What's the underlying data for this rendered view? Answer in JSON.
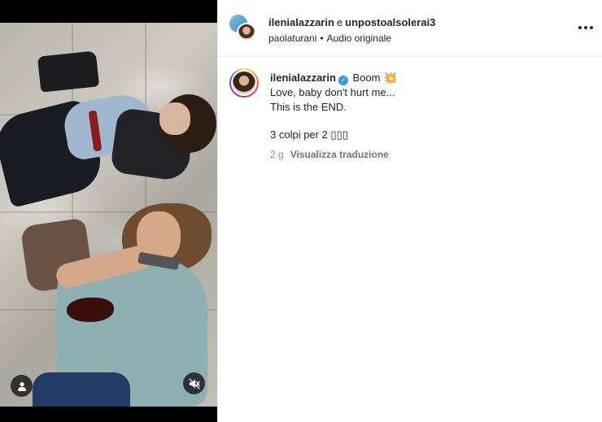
{
  "header": {
    "username1": "ilenialazzarin",
    "conjunction": "e",
    "username2": "unpostoalsolerai3",
    "audio_author": "paolaturani",
    "separator": "•",
    "audio_label": "Audio originale"
  },
  "caption": {
    "username": "ilenialazzarin",
    "verified_glyph": "✓",
    "first_word": "Boom",
    "burst_glyph": "💥",
    "line2": "Love, baby don't hurt me...",
    "line3": "This is the END.",
    "line4": "3 colpi per 2 ▯▯▯",
    "time_ago": "2 g",
    "translate_label": "Visualizza traduzione"
  },
  "icons": {
    "more": "more-options-icon",
    "user": "user-icon",
    "mute": "muted-speaker-icon"
  }
}
